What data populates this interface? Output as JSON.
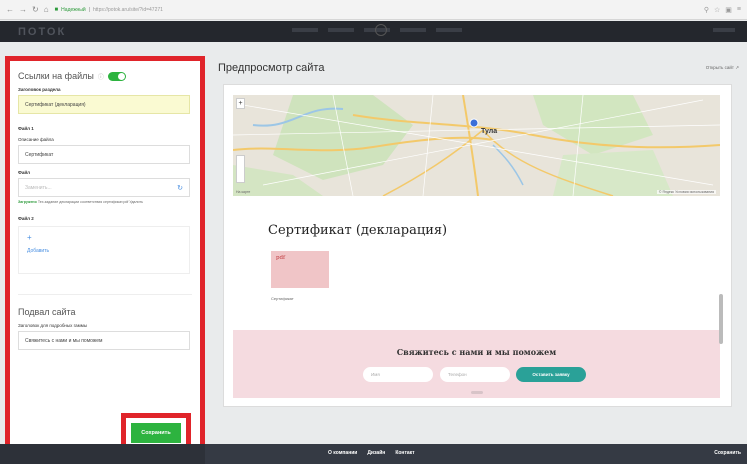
{
  "browser": {
    "site_name": "Надежный",
    "url": "https://potok.aru/site/?id=47271"
  },
  "app": {
    "logo": "ПОТОК"
  },
  "editor": {
    "files_section": {
      "title": "Ссылки на файлы",
      "section_name_label": "Заголовок раздела",
      "section_name_value": "Сертификат (декларация)",
      "file1_label": "Файл 1",
      "file1_desc_label": "Описание файла",
      "file1_desc_value": "Сертификат",
      "file1_file_label": "Файл",
      "file1_file_placeholder": "Заменить...",
      "upload_note_bold": "Загружено",
      "upload_note": "Тех.задание декларации соответствия сертификат.pdf Удалить",
      "file2_label": "Файл 2",
      "file2_plus": "+",
      "file2_add": "Добавить"
    },
    "footer_section": {
      "title": "Подвал сайта",
      "headline_label": "Заголовок для подробных гаммы",
      "headline_value": "Свяжитесь с нами и мы поможем"
    },
    "save_label": "Сохранить"
  },
  "preview": {
    "title": "Предпросмотр сайта",
    "open_link": "Открыть сайт ↗",
    "map": {
      "city": "Тула",
      "address_label": "На карте",
      "attribution": "© Яндекс Условия использования"
    },
    "cert_title": "Сертификат (декларация)",
    "pdf_tag": "pdf",
    "pdf_caption": "Сертификат",
    "contact": {
      "title": "Свяжитесь с нами и мы поможем",
      "name_placeholder": "Имя",
      "phone_placeholder": "Телефон",
      "button": "Оставить заявку"
    }
  },
  "bottom_bar": {
    "links": [
      "О компании",
      "Дизайн",
      "Контакт"
    ],
    "save": "Сохранить"
  }
}
